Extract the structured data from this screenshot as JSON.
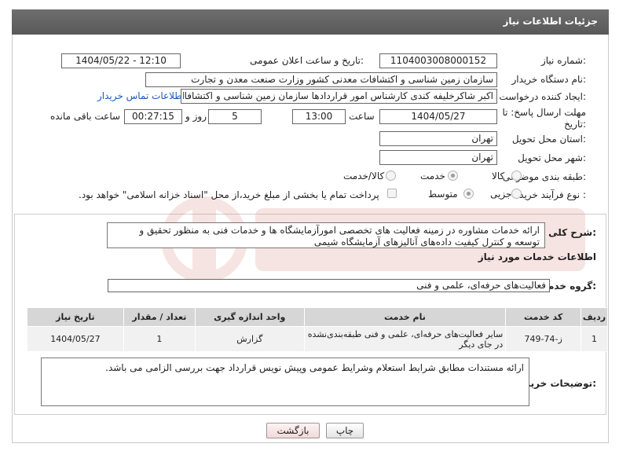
{
  "header": {
    "title": "جزئیات اطلاعات نیاز"
  },
  "fields": {
    "need_number_label": "شماره نیاز:",
    "need_number": "1104003008000152",
    "announce_label": "تاریخ و ساعت اعلان عمومی:",
    "announce_value": "1404/05/22 - 12:10",
    "buyer_org_label": "نام دستگاه خریدار:",
    "buyer_org": "سازمان زمین شناسی و اکتشافات معدنی کشور وزارت صنعت معدن و تجارت",
    "requester_label": "ایجاد کننده درخواست:",
    "requester": "اکبر شاکرخلیفه کندی کارشناس امور قراردادها سازمان زمین شناسی و اکتشافا",
    "contact_link": "اطلاعات تماس خریدار",
    "deadline_label_1": "مهلت ارسال پاسخ: تا",
    "deadline_label_2": "تاریخ:",
    "deadline_date": "1404/05/27",
    "time_label": "ساعت",
    "deadline_time": "13:00",
    "days_value": "5",
    "days_label": "روز و",
    "remaining_time": "00:27:15",
    "remaining_label": "ساعت باقی مانده",
    "province_label": "استان محل تحویل:",
    "province": "تهران",
    "city_label": "شهر محل تحویل:",
    "city": "تهران",
    "category_label": "طبقه بندی موضوعی:",
    "category_options": [
      "کالا",
      "خدمت",
      "کالا/خدمت"
    ],
    "purchase_label": "نوع فرآیند خرید :",
    "purchase_options": [
      "جزیی",
      "متوسط"
    ],
    "payment_note": "پرداخت تمام یا بخشی از مبلغ خرید،از محل \"اسناد خزانه اسلامی\" خواهد بود."
  },
  "summary": {
    "label": "شرح کلی نیاز:",
    "text": "ارائه خدمات مشاوره  در زمینه فعالیت های تخصصی امورآزمایشگاه ها  و خدمات فنی  به منظور تحقیق و توسعه و کنترل کیفیت داده‌های آنالیزهای آزمایشگاه شیمی"
  },
  "services": {
    "heading": "اطلاعات خدمات مورد نیاز",
    "group_label": "گروه خدمت:",
    "group_value": "فعالیت‌های حرفه‌ای، علمی و فنی",
    "columns": [
      "ردیف",
      "کد خدمت",
      "نام خدمت",
      "واحد اندازه گیری",
      "تعداد / مقدار",
      "تاریخ نیاز"
    ],
    "rows": [
      [
        "1",
        "ز-74-749",
        "سایر فعالیت‌های حرفه‌ای، علمی و فنی طبقه‌بندی‌نشده در جای دیگر",
        "گزارش",
        "1",
        "1404/05/27"
      ]
    ]
  },
  "buyer_notes": {
    "label": "توضیحات خریدار:",
    "text": "ارائه مستندات مطابق شرایط استعلام وشرایط عمومی وپیش نویس قرارداد جهت بررسی الزامی می باشد."
  },
  "buttons": {
    "print": "چاپ",
    "back": "بازگشت"
  },
  "colors": {
    "header_bg": "#5f5f5f",
    "link": "#1a5bb8",
    "table_header": "#d6d6d6"
  }
}
